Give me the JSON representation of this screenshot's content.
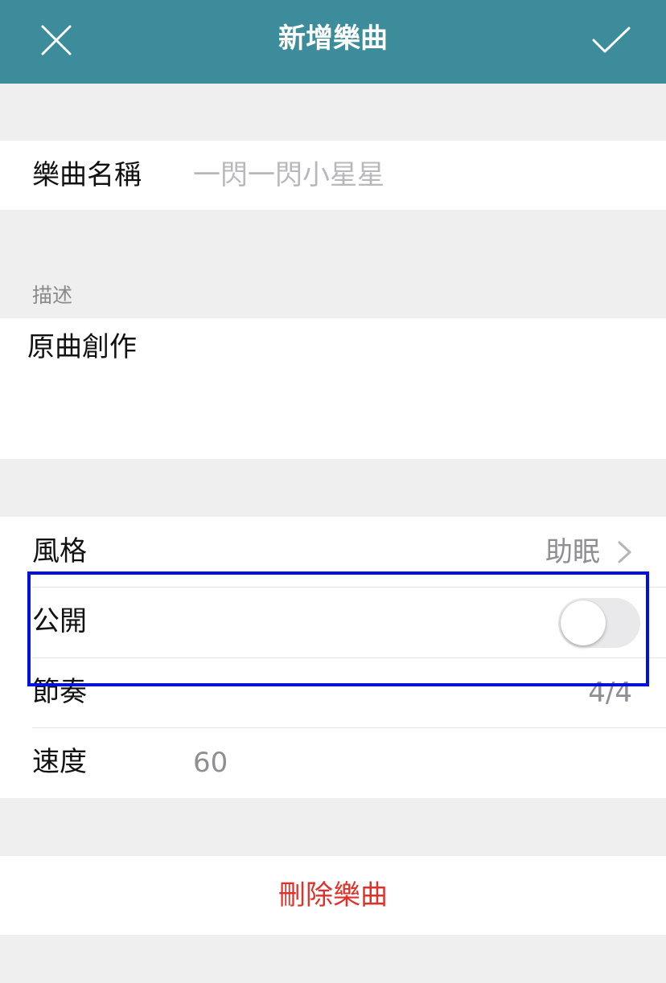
{
  "navbar": {
    "title": "新增樂曲",
    "close_icon": "close-icon",
    "confirm_icon": "checkmark-icon",
    "background": "#3d8c9c"
  },
  "name_row": {
    "label": "樂曲名稱",
    "placeholder": "一閃一閃小星星"
  },
  "description": {
    "header": "描述",
    "value": "原曲創作"
  },
  "settings": {
    "style": {
      "label": "風格",
      "value": "助眠"
    },
    "public": {
      "label": "公開",
      "enabled": false
    },
    "meter": {
      "label": "節奏",
      "value": "4/4"
    },
    "tempo": {
      "label": "速度",
      "value": "60"
    }
  },
  "delete": {
    "label": "刪除樂曲",
    "color": "#e0302a"
  }
}
